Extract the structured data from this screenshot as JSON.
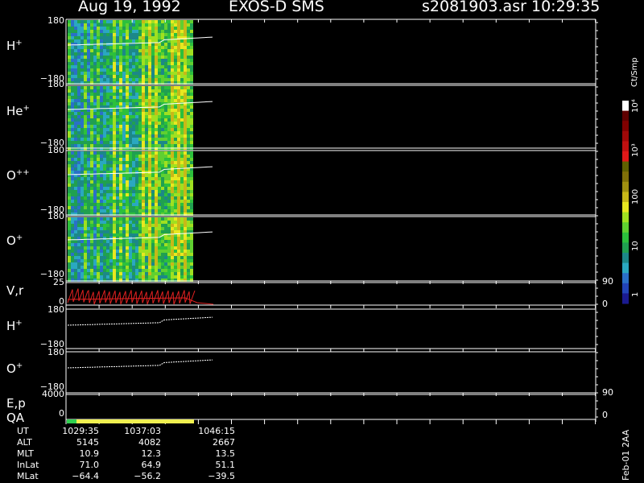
{
  "title": {
    "date": "Aug 19, 1992",
    "instrument": "EXOS-D SMS",
    "file": "s2081903.asr",
    "time": "10:29:35"
  },
  "colorbar": {
    "unit": "Ct/Smp",
    "ticks": [
      "1",
      "10",
      "100",
      "10³",
      "10⁴"
    ],
    "colors": [
      "#1a1a90",
      "#2244b8",
      "#2a70c8",
      "#2aa8c0",
      "#1c8888",
      "#20a050",
      "#2cc03c",
      "#60d030",
      "#a0e020",
      "#e8e820",
      "#c8b818",
      "#a09010",
      "#807008",
      "#606000",
      "#e01818",
      "#c01010",
      "#a00808",
      "#800000",
      "#600000",
      "#ffffff"
    ]
  },
  "panels": {
    "h_plus": {
      "label": "H",
      "sup": "+",
      "ymax": "180",
      "ymin": "−180"
    },
    "he_plus": {
      "label": "He",
      "sup": "+",
      "ymax": "180",
      "ymin": "−180"
    },
    "o_pp": {
      "label": "O",
      "sup": "++",
      "ymax": "180",
      "ymin": "−180"
    },
    "o_plus": {
      "label": "O",
      "sup": "+",
      "ymax": "180",
      "ymin": "−180"
    },
    "vr": {
      "label": "V,r",
      "ytop": "25",
      "ybot": "0",
      "rtop": "90",
      "rbot": "0"
    },
    "h_plus_line": {
      "label": "H",
      "sup": "+",
      "ymax": "180",
      "ymin": "−180"
    },
    "o_plus_line": {
      "label": "O",
      "sup": "+",
      "ymax": "180",
      "ymin": "−180"
    },
    "ep": {
      "label": "E,p",
      "ytop": "4000",
      "ybot": "0",
      "rtop": "90",
      "rbot": "0"
    },
    "qa": {
      "label": "QA"
    }
  },
  "ephemeris": [
    {
      "name": "UT",
      "values": [
        "1029:35",
        "1037:03",
        "1046:15"
      ]
    },
    {
      "name": "ALT",
      "values": [
        "5145",
        "4082",
        "2667"
      ]
    },
    {
      "name": "MLT",
      "values": [
        "10.9",
        "12.3",
        "13.5"
      ]
    },
    {
      "name": "InLat",
      "values": [
        "71.0",
        "64.9",
        "51.1"
      ]
    },
    {
      "name": "MLat",
      "values": [
        "−64.4",
        "−56.2",
        "−39.5"
      ]
    }
  ],
  "footer_stamp": "Feb-01 2AA",
  "chart_data": {
    "type": "heatmap",
    "x_ticks": [
      "1029:35",
      "1037:03",
      "1046:15"
    ],
    "panels": [
      "H+",
      "He+",
      "O++",
      "O+"
    ],
    "ylim": [
      -180,
      180
    ],
    "colorbar_range": [
      1,
      10000
    ],
    "colorbar_scale": "log",
    "lines": {
      "trace_angle": [
        -12,
        -10,
        -8,
        -4,
        0,
        6,
        14
      ],
      "vr_red": "sawtooth",
      "qa_colors": [
        "#30d050",
        "#f0f050"
      ]
    }
  }
}
